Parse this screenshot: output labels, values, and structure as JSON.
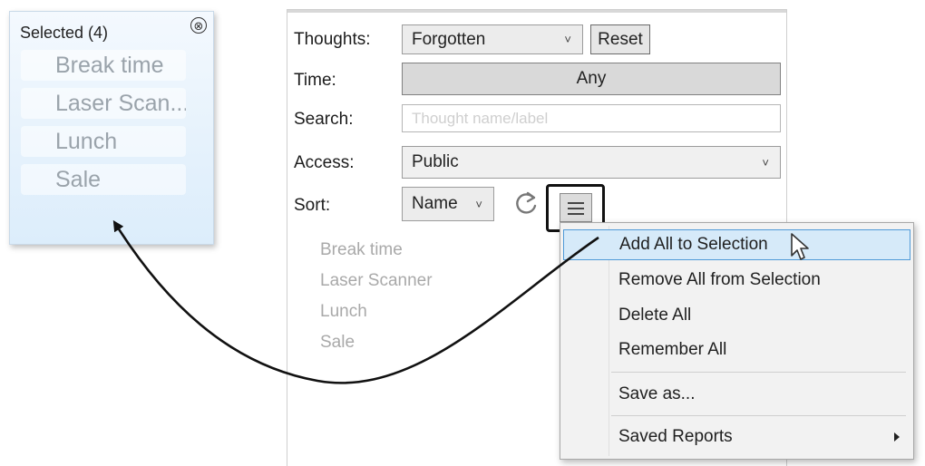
{
  "selected_panel": {
    "title": "Selected (4)",
    "close_glyph": "⊗",
    "items": [
      "Break time",
      "Laser Scan...",
      "Lunch",
      "Sale"
    ]
  },
  "filters": {
    "thoughts": {
      "label": "Thoughts:",
      "value": "Forgotten",
      "reset_label": "Reset"
    },
    "time": {
      "label": "Time:",
      "value": "Any"
    },
    "search": {
      "label": "Search:",
      "placeholder": "Thought name/label",
      "value": ""
    },
    "access": {
      "label": "Access:",
      "value": "Public"
    },
    "sort": {
      "label": "Sort:",
      "value": "Name"
    },
    "chevron_glyph": "˅"
  },
  "results": [
    "Break time",
    "Laser Scanner",
    "Lunch",
    "Sale"
  ],
  "context_menu": {
    "items": [
      "Add All to Selection",
      "Remove All from Selection",
      "Delete All",
      "Remember All",
      "Save as...",
      "Saved Reports"
    ]
  },
  "icons": {
    "refresh": "refresh-icon",
    "menu": "hamburger-menu-icon",
    "close": "close-circle-icon",
    "cursor": "mouse-pointer-icon"
  },
  "colors": {
    "panel_gradient_top": "#f4f9fe",
    "menu_hover_bg": "#d6eaf9",
    "menu_hover_border": "#4f9ad8",
    "disabled_text": "#a9a9a9"
  }
}
